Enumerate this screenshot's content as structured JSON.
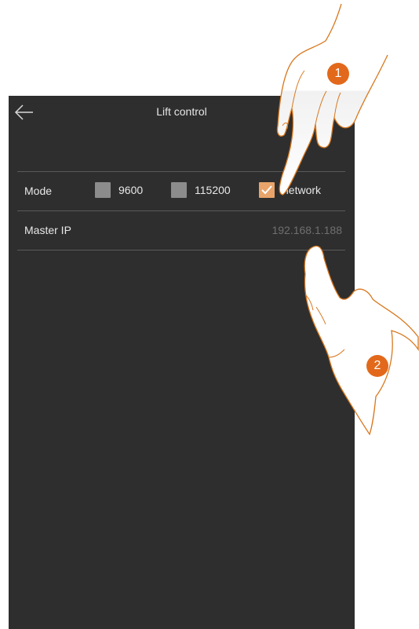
{
  "header": {
    "title": "Lift control",
    "back_icon": "arrow-left-icon"
  },
  "mode": {
    "label": "Mode",
    "options": [
      {
        "label": "9600",
        "checked": false
      },
      {
        "label": "115200",
        "checked": false
      },
      {
        "label": "network",
        "checked": true
      }
    ]
  },
  "master_ip": {
    "label": "Master IP",
    "value": "192.168.1.188"
  },
  "steps": [
    "1",
    "2"
  ],
  "colors": {
    "screen_bg": "#2e2e2e",
    "checkbox_off": "#8c8c8c",
    "checkbox_on": "#e8a46a",
    "step_badge": "#e2691b"
  }
}
